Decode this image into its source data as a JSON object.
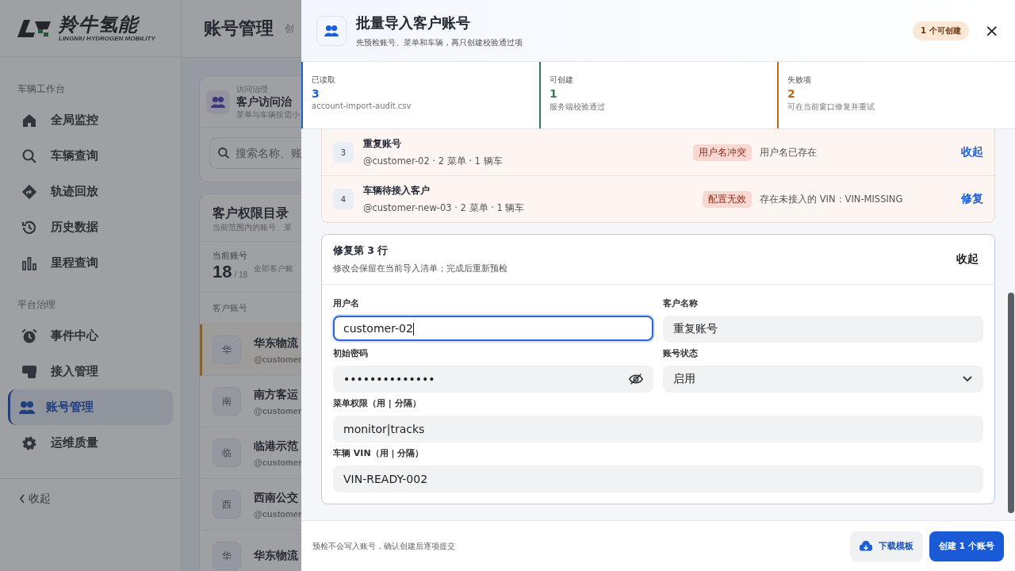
{
  "brand": {
    "name": "羚牛氢能",
    "tagline": "LINGNIU HYDROGEN MOBILITY"
  },
  "sidebar": {
    "groups": [
      {
        "title": "车辆工作台",
        "items": [
          {
            "label": "全局监控",
            "kind": "home",
            "selected": false
          },
          {
            "label": "车辆查询",
            "kind": "search",
            "selected": false
          },
          {
            "label": "轨迹回放",
            "kind": "route",
            "selected": false
          },
          {
            "label": "历史数据",
            "kind": "history",
            "selected": false
          },
          {
            "label": "里程查询",
            "kind": "bars",
            "selected": false
          }
        ]
      },
      {
        "title": "平台治理",
        "items": [
          {
            "label": "事件中心",
            "kind": "alarm",
            "selected": false
          },
          {
            "label": "接入管理",
            "kind": "device",
            "selected": false
          },
          {
            "label": "账号管理",
            "kind": "users",
            "selected": true
          },
          {
            "label": "运维质量",
            "kind": "gear",
            "selected": false
          }
        ]
      }
    ],
    "collapse": "收起"
  },
  "page": {
    "title": "账号管理",
    "subtitle": "创",
    "access_card": {
      "eyebrow": "访问治理",
      "title": "客户访问治",
      "desc": "菜单与车辆按需小",
      "search_placeholder": "搜索名称、账"
    },
    "directory": {
      "title": "客户权限目录",
      "desc": "当前范围内的账号、菜",
      "count_label": "当前账号",
      "count": "18",
      "total": "/ 18",
      "filter": "全部客户账",
      "column": "客户账号",
      "rows": [
        {
          "avatar": "华",
          "name": "华东物流",
          "handle": "@customer",
          "selected": true
        },
        {
          "avatar": "南",
          "name": "南方客运",
          "handle": "@customer",
          "selected": false
        },
        {
          "avatar": "临",
          "name": "临港示范",
          "handle": "@customer",
          "selected": false
        },
        {
          "avatar": "西",
          "name": "西南公交",
          "handle": "@customer",
          "selected": false
        },
        {
          "avatar": "华",
          "name": "华东物流",
          "selected": false
        }
      ]
    }
  },
  "drawer": {
    "title": "批量导入客户账号",
    "subtitle": "先预检账号、菜单和车辆，再只创建校验通过项",
    "badge": "1 个可创建",
    "close": "×",
    "stats": [
      {
        "label": "已读取",
        "value": "3",
        "note": "account-import-audit.csv",
        "color": "#1d5fd6"
      },
      {
        "label": "可创建",
        "value": "1",
        "note": "服务端校验通过",
        "color": "#2f7d4f"
      },
      {
        "label": "失败项",
        "value": "2",
        "note": "可在当前窗口修复并重试",
        "color": "#b8661c"
      }
    ],
    "rows": [
      {
        "index": "3",
        "name": "重复账号",
        "meta": "@customer-02 · 2 菜单 · 1 辆车",
        "tag": "用户名冲突",
        "reason": "用户名已存在",
        "action": "收起"
      },
      {
        "index": "4",
        "name": "车辆待接入客户",
        "meta": "@customer-new-03 · 2 菜单 · 1 辆车",
        "tag": "配置无效",
        "reason": "存在未接入的 VIN：VIN-MISSING",
        "action": "修复"
      }
    ],
    "fix": {
      "title": "修复第 3 行",
      "desc": "修改会保留在当前导入清单；完成后重新预检",
      "collapse": "收起",
      "fields": [
        {
          "label": "用户名",
          "kind": "text",
          "value": "customer-02",
          "focused": true
        },
        {
          "label": "客户名称",
          "kind": "text",
          "value": "重复账号",
          "focused": false
        },
        {
          "label": "初始密码",
          "kind": "password",
          "value": "••••••••••••••",
          "focused": false
        },
        {
          "label": "账号状态",
          "kind": "select",
          "value": "启用",
          "focused": false
        },
        {
          "label": "菜单权限（用 | 分隔）",
          "kind": "line",
          "value": "monitor|tracks",
          "focused": false
        },
        {
          "label": "车辆 VIN（用 | 分隔）",
          "kind": "line",
          "value": "VIN-READY-002",
          "focused": false
        }
      ]
    },
    "footer_note": "预检不会写入账号，确认创建后逐项提交",
    "download": "下载模板",
    "create": "创建 1 个账号"
  }
}
